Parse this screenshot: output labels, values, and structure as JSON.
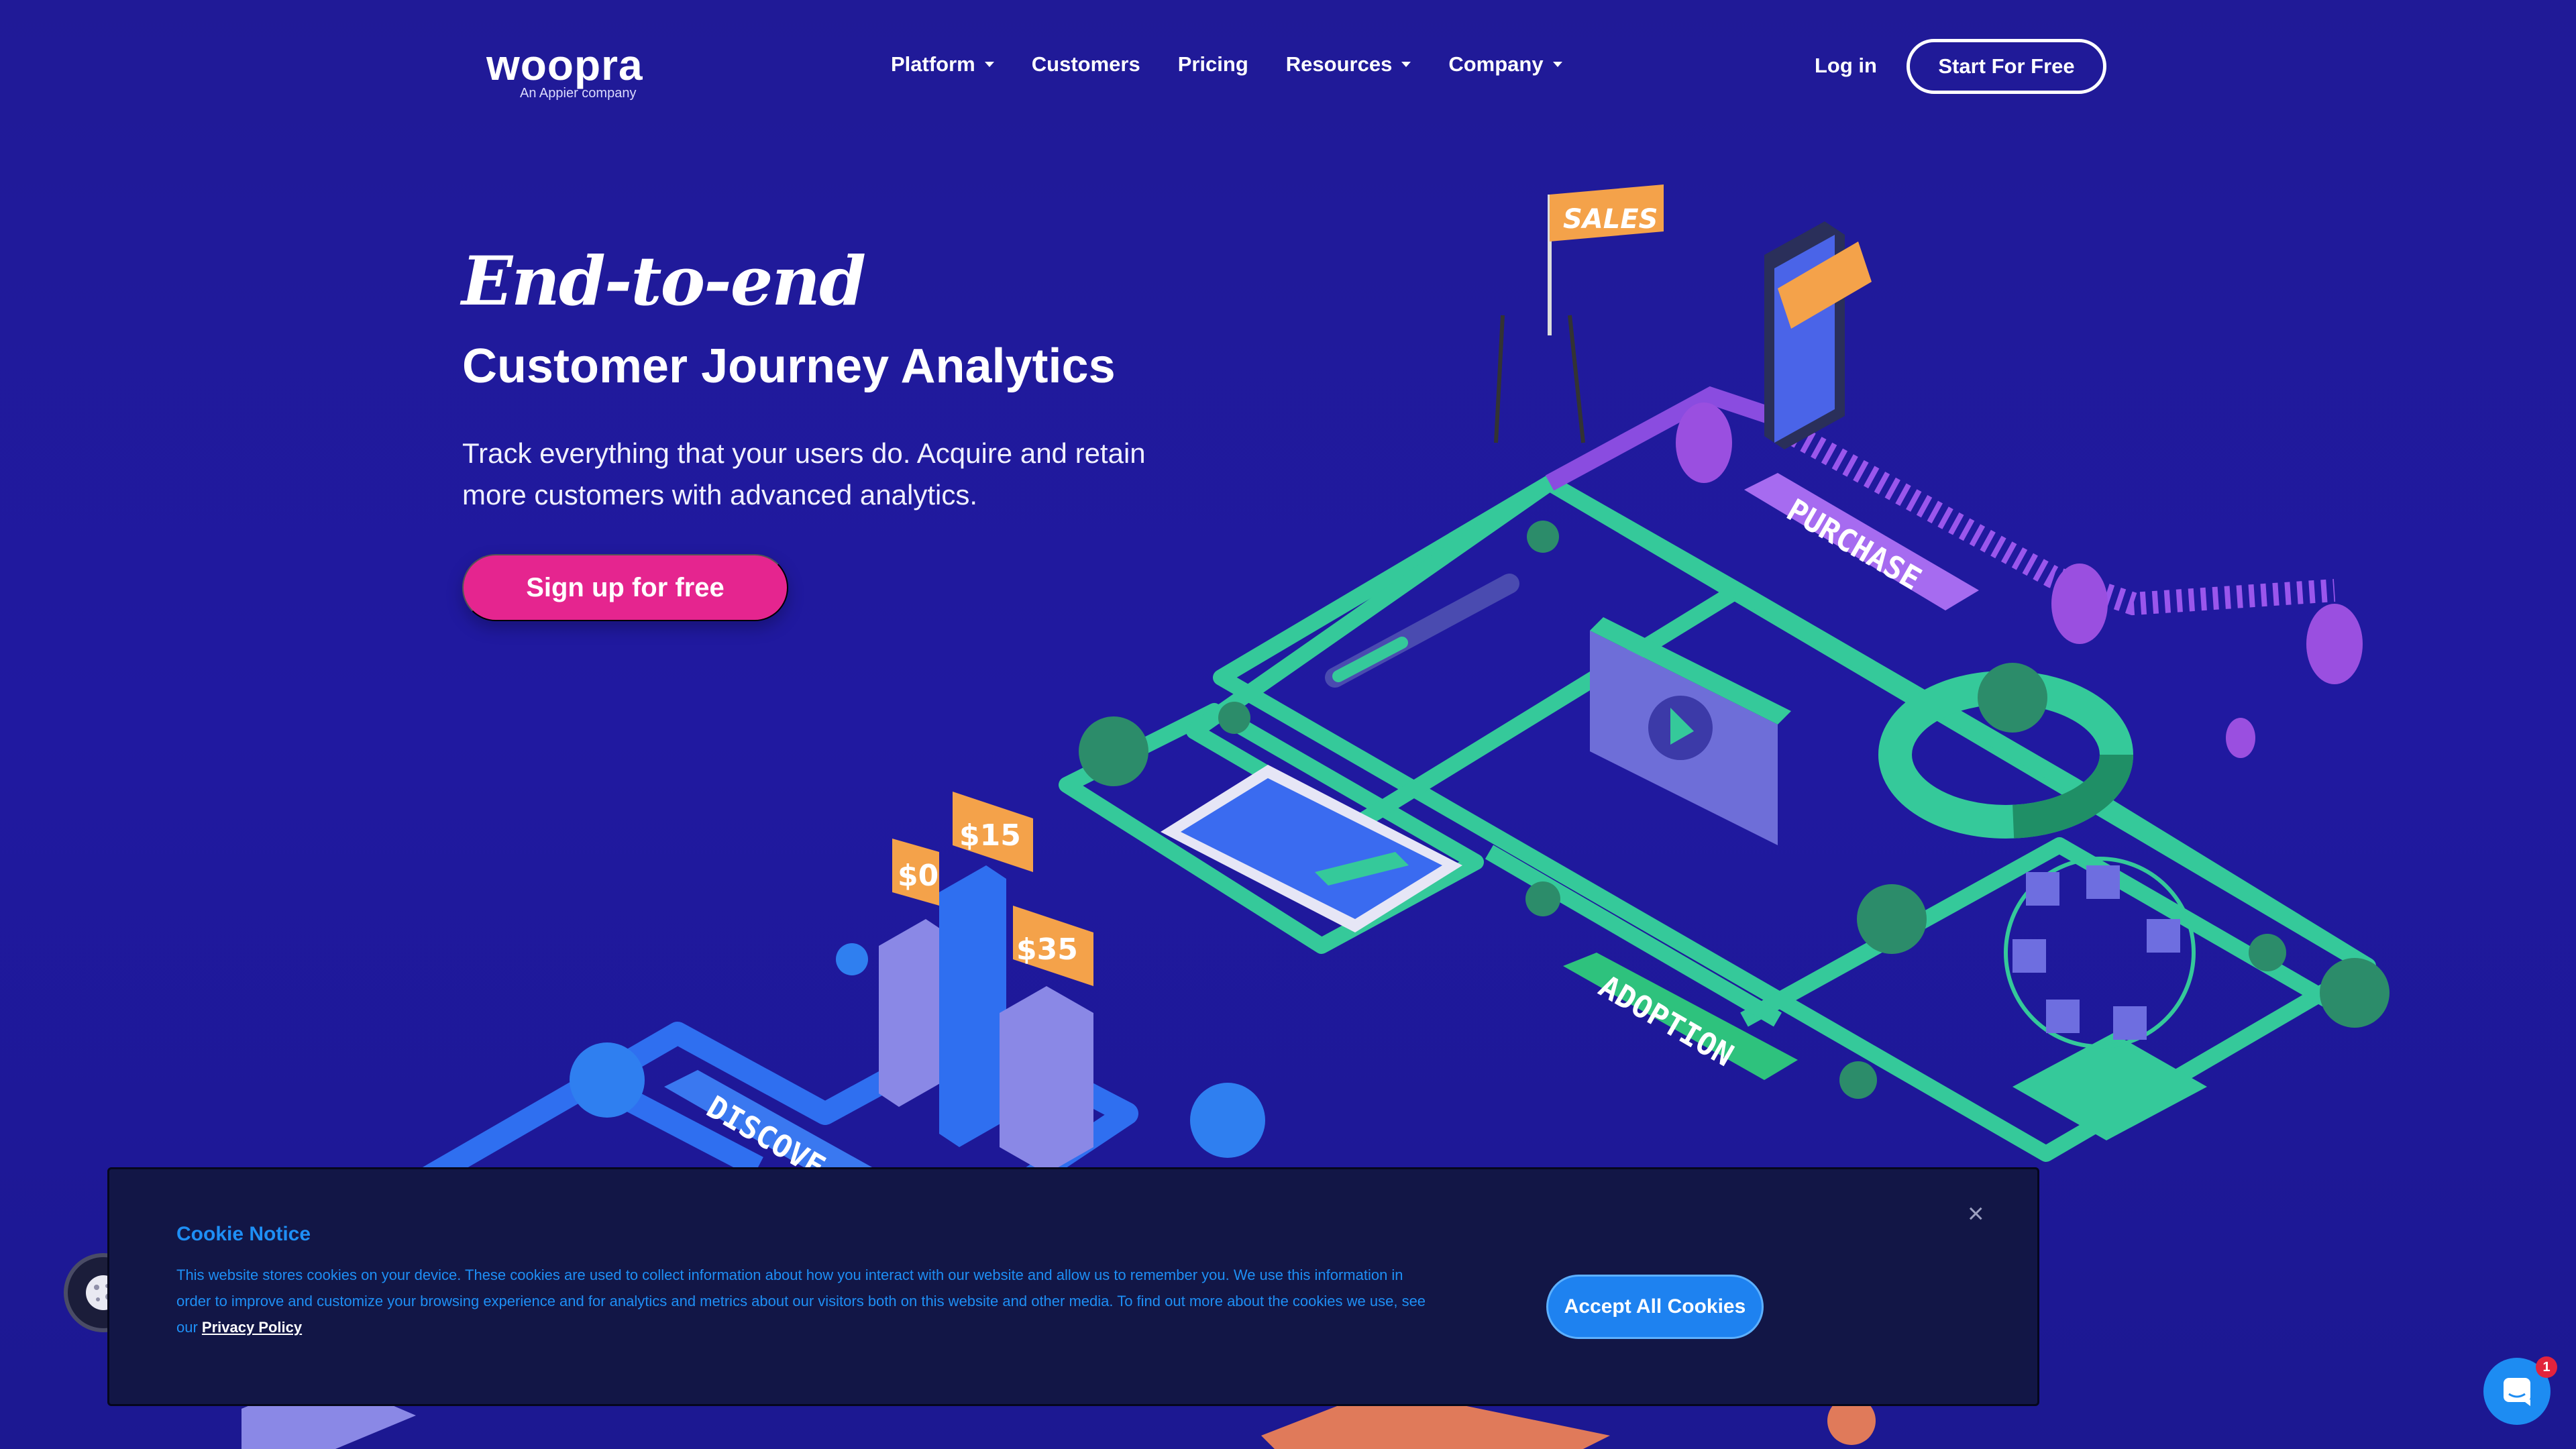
{
  "brand": {
    "logo": "woopra",
    "tagline": "An Appier company"
  },
  "nav": {
    "items": [
      {
        "label": "Platform",
        "dropdown": true
      },
      {
        "label": "Customers",
        "dropdown": false
      },
      {
        "label": "Pricing",
        "dropdown": false
      },
      {
        "label": "Resources",
        "dropdown": true
      },
      {
        "label": "Company",
        "dropdown": true
      }
    ],
    "login": "Log in",
    "cta": "Start For Free"
  },
  "hero": {
    "script_title": "End-to-end",
    "title": "Customer Journey Analytics",
    "lead": "Track everything that your users do. Acquire and retain more customers with advanced analytics.",
    "cta": "Sign up for free"
  },
  "illustration": {
    "labels": {
      "sales": "SALES",
      "purchase": "PURCHASE",
      "adoption": "ADOPTION",
      "discovery": "DISCOVE",
      "price1": "$0",
      "price2": "$15",
      "price3": "$35"
    }
  },
  "cookie": {
    "title": "Cookie Notice",
    "text": "This website stores cookies on your device. These cookies are used to collect information about how you interact with our website and allow us to remember you. We use this information in order to improve and customize your browsing experience and for analytics and metrics about our visitors both on this website and other media. To find out more about the cookies we use, see our ",
    "link": "Privacy Policy",
    "accept": "Accept All Cookies",
    "close": "×"
  },
  "chat": {
    "badge": "1"
  },
  "colors": {
    "background": "#201a97",
    "pink_cta": "#e5258f",
    "path_green": "#35c99a",
    "path_blue": "#2f6ff0",
    "purple": "#8a4ce0",
    "cookie_bg": "#121646",
    "cookie_blue": "#1e8ff5"
  }
}
